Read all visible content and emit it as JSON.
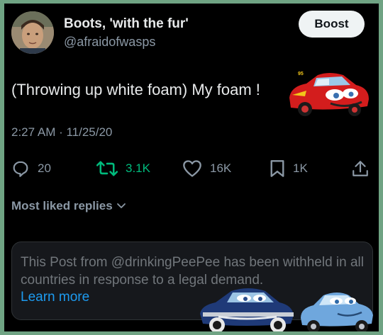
{
  "tweet": {
    "display_name": "Boots, 'with the fur'",
    "handle": "@afraidofwasps",
    "boost_label": "Boost",
    "text": "(Throwing up white foam) My foam !",
    "timestamp": "2:27 AM · 11/25/20"
  },
  "actions": {
    "replies": "20",
    "retweets": "3.1K",
    "likes": "16K",
    "bookmarks": "1K"
  },
  "replies_section": {
    "label": "Most liked replies"
  },
  "withheld_notice": {
    "text": "This Post from @drinkingPeePee has been withheld in all countries in response to a legal demand.",
    "link": "Learn more"
  },
  "colors": {
    "background": "#000000",
    "border": "#6fa383",
    "accent_blue": "#1d9bf0",
    "retweet_green": "#00ba7c"
  },
  "icons": [
    "reply-icon",
    "retweet-icon",
    "like-icon",
    "bookmark-icon",
    "share-icon",
    "chevron-down-icon"
  ]
}
